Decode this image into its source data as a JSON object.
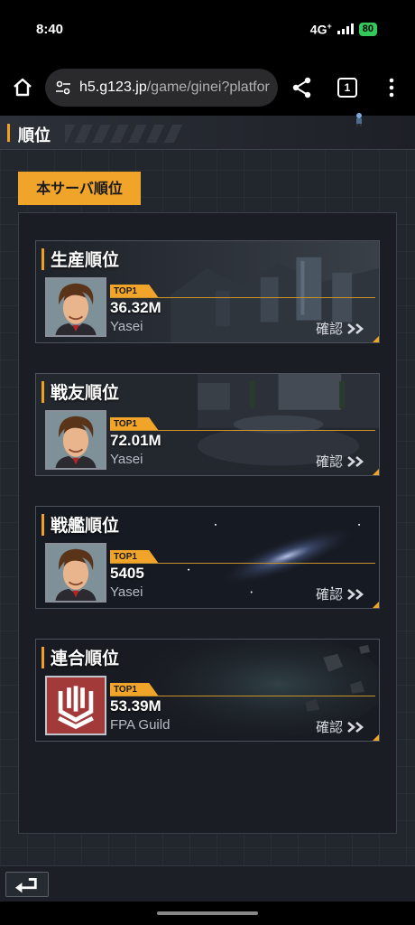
{
  "status": {
    "time": "8:40",
    "network": "4G",
    "network_sup": "+",
    "battery": "80"
  },
  "browser": {
    "url_host": "h5.g123.jp",
    "url_path": "/game/ginei?platfor",
    "tab_count": "1"
  },
  "game": {
    "header_title": "順位",
    "server_tab": "本サーバ順位",
    "cards": [
      {
        "title": "生産順位",
        "badge": "TOP1",
        "value": "36.32M",
        "name": "Yasei",
        "confirm": "確認",
        "avatar": "portrait"
      },
      {
        "title": "戦友順位",
        "badge": "TOP1",
        "value": "72.01M",
        "name": "Yasei",
        "confirm": "確認",
        "avatar": "portrait"
      },
      {
        "title": "戦艦順位",
        "badge": "TOP1",
        "value": "5405",
        "name": "Yasei",
        "confirm": "確認",
        "avatar": "portrait"
      },
      {
        "title": "連合順位",
        "badge": "TOP1",
        "value": "53.39M",
        "name": "FPA Guild",
        "confirm": "確認",
        "avatar": "guild-emblem"
      }
    ]
  },
  "colors": {
    "accent": "#f0a52a",
    "panel": "#1a1d23",
    "guild": "#a23a3a"
  }
}
